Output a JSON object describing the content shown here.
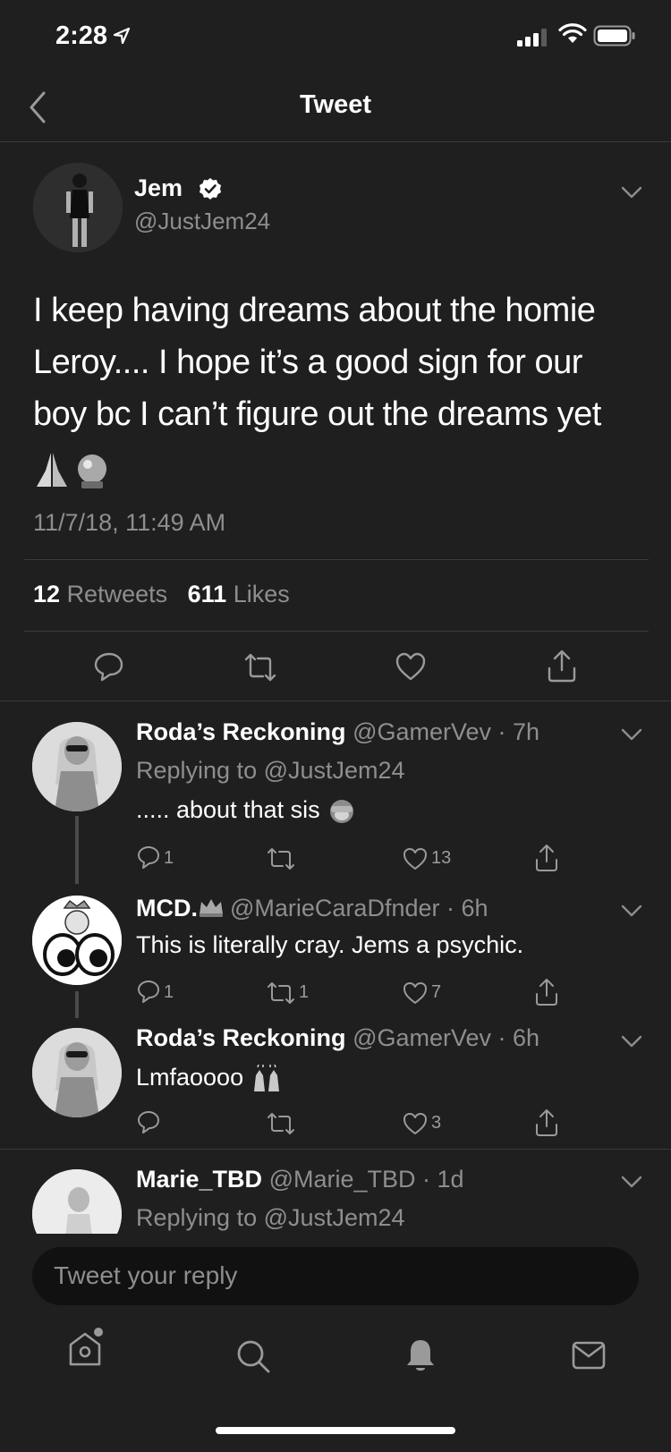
{
  "status_bar": {
    "time": "2:28"
  },
  "header": {
    "title": "Tweet"
  },
  "tweet": {
    "author_name": "Jem",
    "author_handle": "@JustJem24",
    "text_lines": [
      "I keep having dreams about the homie",
      "Leroy.... I hope it’s a good sign for our",
      "boy  bc I can’t figure out the dreams yet"
    ],
    "emojis": "🙏🔮",
    "timestamp": "11/7/18, 11:49 AM",
    "retweets_count": "12",
    "retweets_label": "Retweets",
    "likes_count": "611",
    "likes_label": "Likes"
  },
  "replies": [
    {
      "name": "Roda’s Reckoning",
      "handle": "@GamerVev",
      "time": "7h",
      "replying_to": "Replying to @JustJem24",
      "text": "..... about that sis",
      "emoji": "🙊",
      "reply_count": "1",
      "retweet_count": "",
      "like_count": "13"
    },
    {
      "name": "MCD.",
      "name_emoji": "👑",
      "handle": "@MarieCaraDfnder",
      "time": "6h",
      "text": "This is literally cray. Jems a psychic.",
      "reply_count": "1",
      "retweet_count": "1",
      "like_count": "7"
    },
    {
      "name": "Roda’s Reckoning",
      "handle": "@GamerVev",
      "time": "6h",
      "text": "Lmfaoooo",
      "emoji": "🙌",
      "reply_count": "",
      "retweet_count": "",
      "like_count": "3"
    },
    {
      "name": "Marie_TBD",
      "handle": "@Marie_TBD",
      "time": "1d",
      "replying_to": "Replying to @JustJem24"
    }
  ],
  "reply_bar": {
    "placeholder": "Tweet your reply"
  },
  "tab_bar": {
    "items": [
      "home-icon",
      "search-icon",
      "notifications-icon",
      "messages-icon"
    ]
  }
}
